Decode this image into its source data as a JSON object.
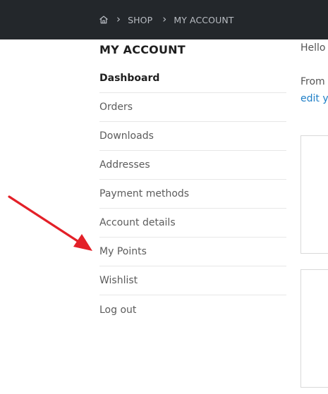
{
  "breadcrumb": {
    "home_icon": "home-icon",
    "items": [
      "SHOP",
      "MY ACCOUNT"
    ]
  },
  "sidebar": {
    "title": "MY ACCOUNT",
    "items": [
      "Dashboard",
      "Orders",
      "Downloads",
      "Addresses",
      "Payment methods",
      "Account details",
      "My Points",
      "Wishlist",
      "Log out"
    ]
  },
  "main": {
    "greeting": "Hello",
    "description_start": "From",
    "edit_link": "edit y"
  },
  "annotation": {
    "arrow_color": "#e32028",
    "points_to": "My Points"
  }
}
